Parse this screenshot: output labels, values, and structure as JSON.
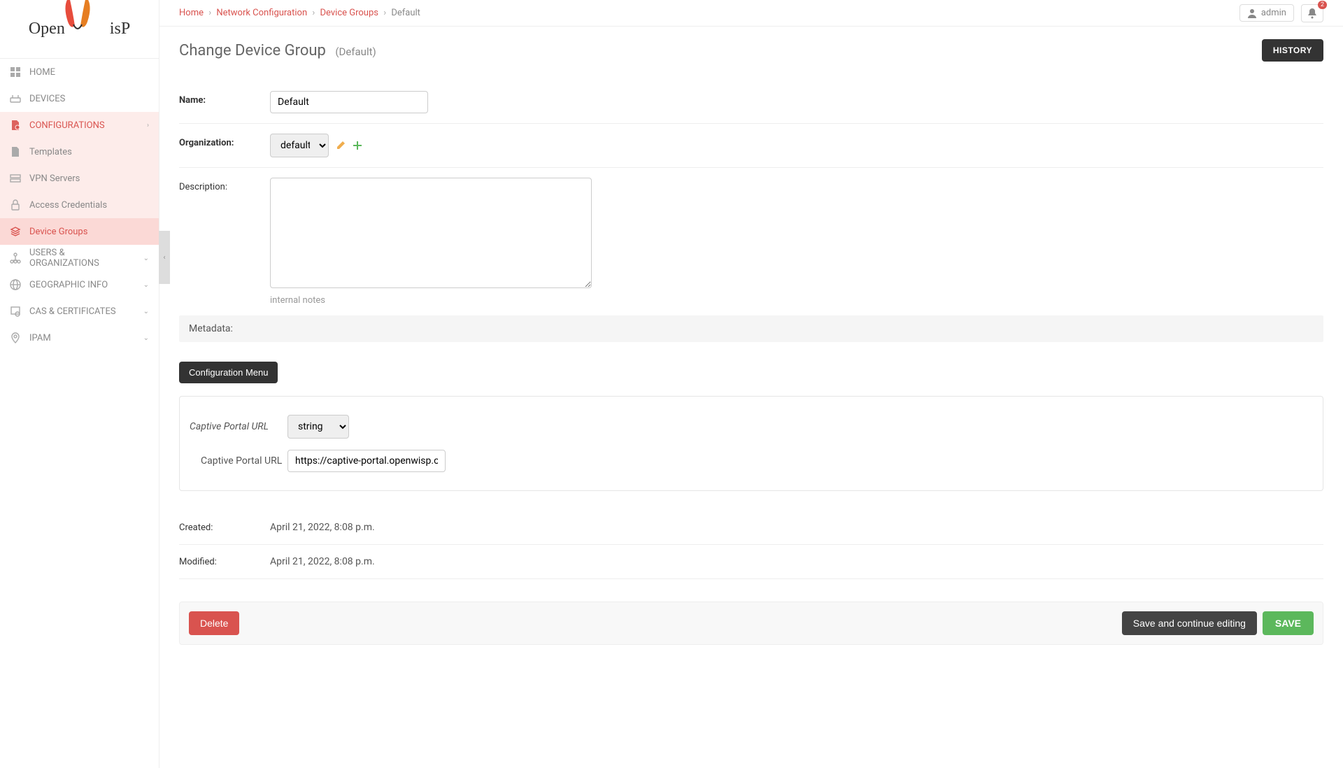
{
  "brand": "OpenWISP",
  "topbar": {
    "user_label": "admin",
    "notif_count": "2"
  },
  "breadcrumb": {
    "home": "Home",
    "net_cfg": "Network Configuration",
    "dev_groups": "Device Groups",
    "current": "Default"
  },
  "sidebar": {
    "home": "HOME",
    "devices": "DEVICES",
    "configurations": "CONFIGURATIONS",
    "templates": "Templates",
    "vpn_servers": "VPN Servers",
    "access_credentials": "Access Credentials",
    "device_groups": "Device Groups",
    "users_orgs": "USERS & ORGANIZATIONS",
    "geo_info": "GEOGRAPHIC INFO",
    "cas_certs": "CAS & CERTIFICATES",
    "ipam": "IPAM"
  },
  "page": {
    "title": "Change Device Group",
    "subtitle": "(Default)",
    "history_btn": "HISTORY"
  },
  "form": {
    "name_label": "Name:",
    "name_value": "Default",
    "org_label": "Organization:",
    "org_value": "default",
    "desc_label": "Description:",
    "desc_value": "",
    "desc_help": "internal notes",
    "metadata_label": "Metadata:",
    "config_menu_btn": "Configuration Menu",
    "cp_url_label_italic": "Captive Portal URL",
    "cp_url_type": "string",
    "cp_url_label": "Captive Portal URL",
    "cp_url_value": "https://captive-portal.openwisp.org",
    "created_label": "Created:",
    "created_value": "April 21, 2022, 8:08 p.m.",
    "modified_label": "Modified:",
    "modified_value": "April 21, 2022, 8:08 p.m."
  },
  "actions": {
    "delete": "Delete",
    "save_continue": "Save and continue editing",
    "save": "SAVE"
  }
}
